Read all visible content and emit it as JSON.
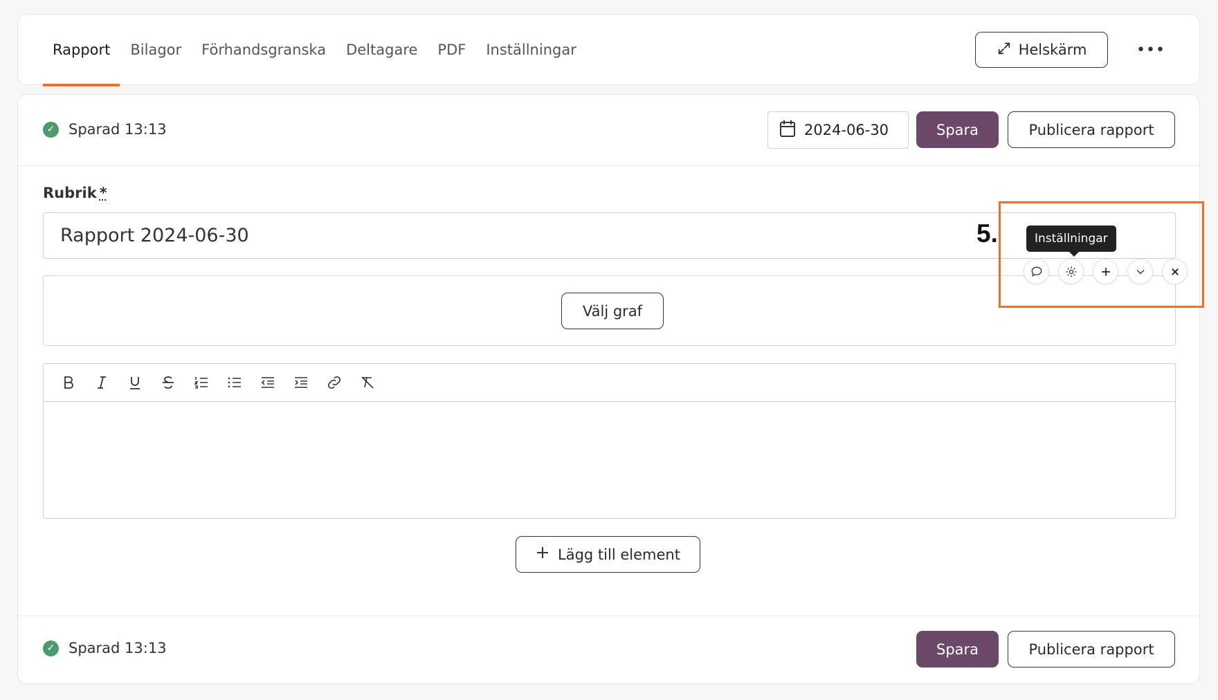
{
  "tabs": [
    {
      "label": "Rapport",
      "active": true
    },
    {
      "label": "Bilagor"
    },
    {
      "label": "Förhandsgranska"
    },
    {
      "label": "Deltagare"
    },
    {
      "label": "PDF"
    },
    {
      "label": "Inställningar"
    }
  ],
  "header": {
    "fullscreen_label": "Helskärm",
    "more_label": "•••"
  },
  "status": {
    "saved_text": "Sparad 13:13"
  },
  "date_input": {
    "value": "2024-06-30"
  },
  "actions": {
    "save_label": "Spara",
    "publish_label": "Publicera rapport"
  },
  "form": {
    "rubrik_label": "Rubrik",
    "required_marker": "*",
    "rubrik_value": "Rapport 2024-06-30"
  },
  "annotation": {
    "step": "5."
  },
  "tooltip": {
    "text": "Inställningar"
  },
  "graph": {
    "choose_label": "Välj graf"
  },
  "add_element": {
    "label": "Lägg till element"
  },
  "colors": {
    "accent": "#e8712e",
    "primary": "#6c4868",
    "success": "#4d9a6c"
  }
}
